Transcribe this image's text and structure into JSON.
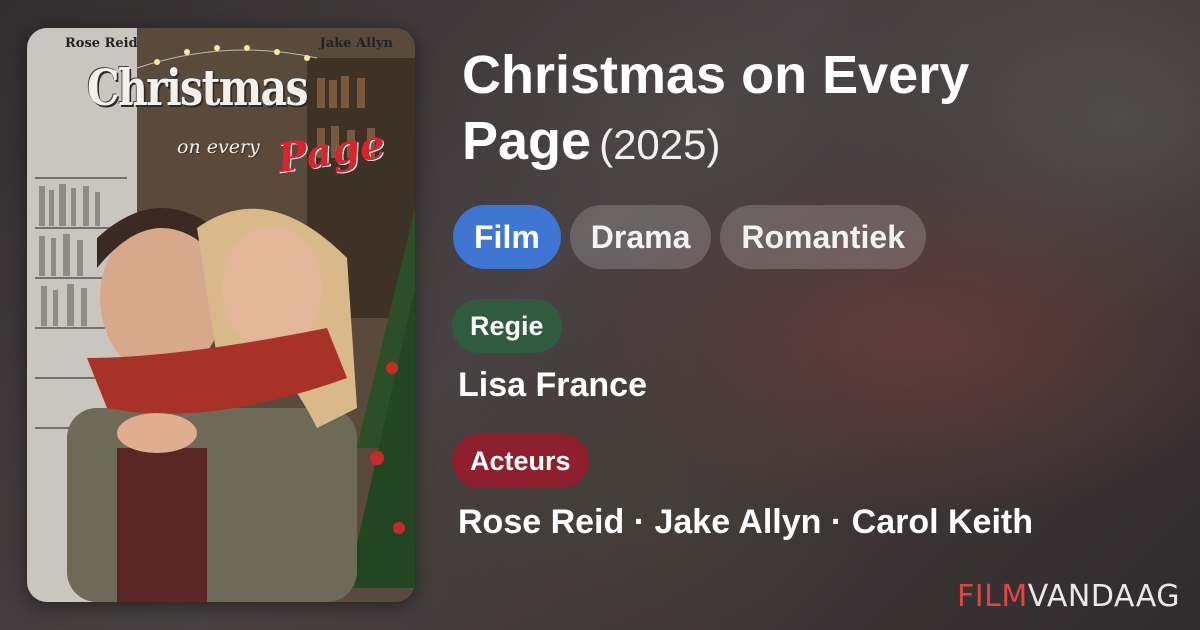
{
  "movie": {
    "title": "Christmas on Every Page",
    "year": "(2025)"
  },
  "genres": [
    "Film",
    "Drama",
    "Romantiek"
  ],
  "active_genre": "Film",
  "director_section": {
    "label": "Regie",
    "names": "Lisa France"
  },
  "cast_section": {
    "label": "Acteurs",
    "names": "Rose Reid · Jake Allyn · Carol Keith"
  },
  "poster": {
    "actor_left": "Rose Reid",
    "actor_right": "Jake Allyn",
    "title_line1": "Christmas",
    "title_line2a": "on every",
    "title_line2b": "Page"
  },
  "brand": {
    "part1": "FILM",
    "part2": "VANDAAG"
  },
  "colors": {
    "film_chip": "#3f76d3",
    "regie_badge": "#2f5b3e",
    "acteurs_badge": "#8e1f2c",
    "brand_red": "#e0463f"
  }
}
